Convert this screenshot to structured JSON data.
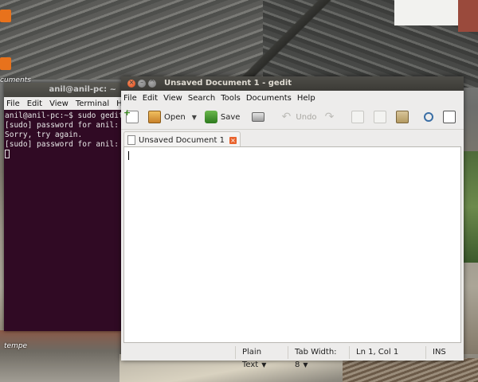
{
  "desktop": {
    "icon_labels": [
      "cuments",
      "tempe"
    ]
  },
  "terminal": {
    "title": "anil@anil-pc: ~",
    "menu": [
      "File",
      "Edit",
      "View",
      "Terminal",
      "Help"
    ],
    "lines": [
      "anil@anil-pc:~$ sudo gedit",
      "[sudo] password for anil:",
      "Sorry, try again.",
      "[sudo] password for anil:"
    ]
  },
  "gedit": {
    "title": "Unsaved Document 1 - gedit",
    "window_buttons": {
      "close": "×",
      "minimize": "–",
      "maximize": "^"
    },
    "menu": [
      "File",
      "Edit",
      "View",
      "Search",
      "Tools",
      "Documents",
      "Help"
    ],
    "toolbar": {
      "open_label": "Open",
      "open_dropdown": "▼",
      "save_label": "Save",
      "undo_label": "Undo",
      "undo_glyph": "↶",
      "redo_glyph": "↷"
    },
    "tab": {
      "label": "Unsaved Document 1",
      "close": "×"
    },
    "status": {
      "language": "Plain Text",
      "tab_width": "Tab Width:  8",
      "position": "Ln 1, Col 1",
      "mode": "INS",
      "dropdown": "▼"
    }
  }
}
